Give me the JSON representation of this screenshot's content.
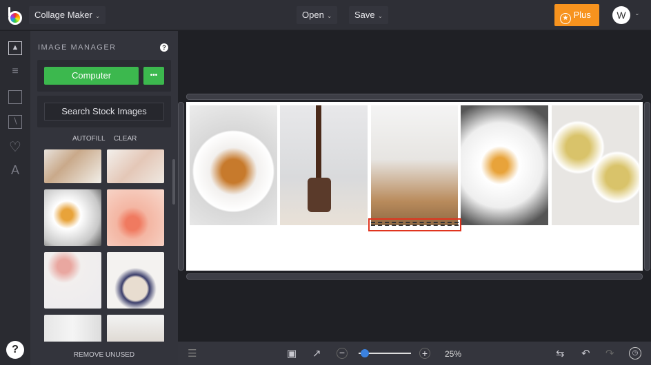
{
  "header": {
    "app_menu": "Collage Maker",
    "open": "Open",
    "save": "Save",
    "plus": "Plus",
    "avatar": "W"
  },
  "rail": {
    "icons": [
      "image-icon",
      "sliders-icon",
      "layout-icon",
      "texture-icon",
      "heart-icon",
      "text-icon"
    ]
  },
  "panel": {
    "title": "IMAGE MANAGER",
    "computer": "Computer",
    "more": "•••",
    "search": "Search Stock Images",
    "autofill": "AUTOFILL",
    "clear": "CLEAR",
    "remove_unused": "REMOVE UNUSED"
  },
  "bottom": {
    "zoom": "25%",
    "zoom_fraction": 0.1
  },
  "colors": {
    "accent_green": "#3cb84e",
    "plus_orange": "#f7931e",
    "selection": "#e0341e",
    "slider": "#3b82e0"
  }
}
